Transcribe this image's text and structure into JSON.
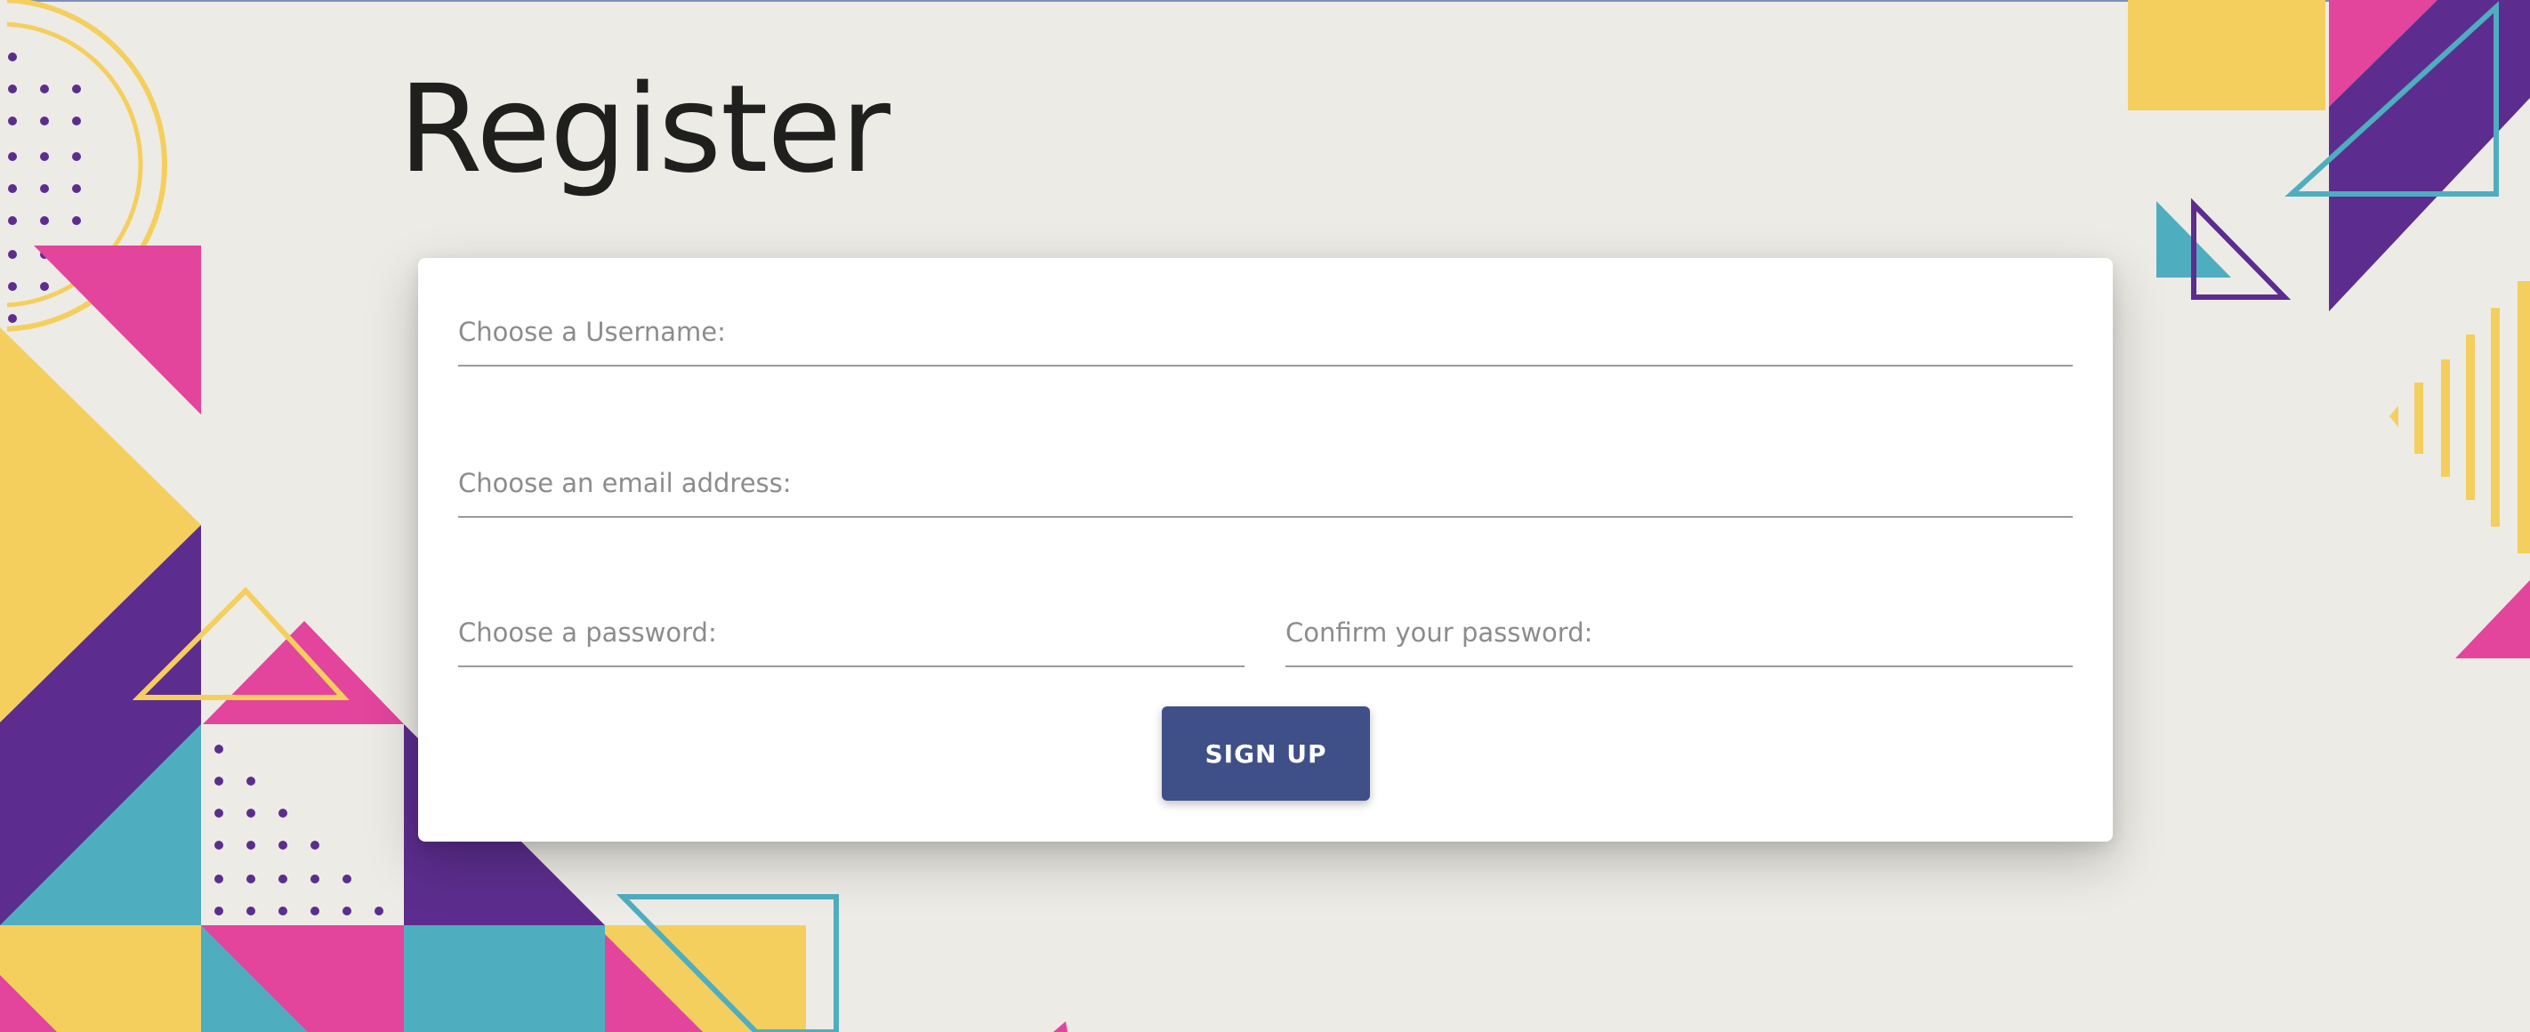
{
  "page": {
    "title": "Register"
  },
  "form": {
    "username": {
      "placeholder": "Choose a Username:",
      "value": ""
    },
    "email": {
      "placeholder": "Choose an email address:",
      "value": ""
    },
    "password": {
      "placeholder": "Choose a password:",
      "value": ""
    },
    "confirm_password": {
      "placeholder": "Confirm your password:",
      "value": ""
    },
    "submit_label": "SIGN UP"
  },
  "colors": {
    "background": "#edebe6",
    "button": "#3f4f87",
    "yellow": "#f4cf5e",
    "pink": "#e3449c",
    "purple": "#5c2d8e",
    "teal": "#4eaec0"
  }
}
